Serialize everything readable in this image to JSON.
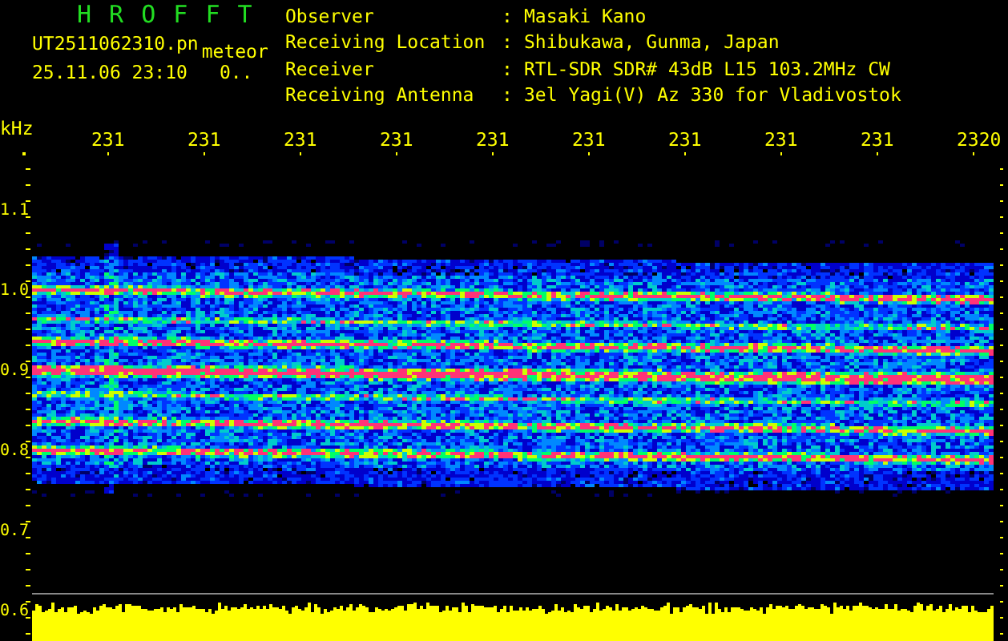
{
  "header": {
    "app_title": "H R O F F T",
    "file_name": "UT2511062310.pn",
    "mode": "meteor",
    "timestamp": "25.11.06 23:10",
    "count": "0..",
    "fields": [
      {
        "label": "Observer",
        "separator": ":",
        "value": "Masaki Kano"
      },
      {
        "label": "Receiving Location",
        "separator": ":",
        "value": "Shibukawa, Gunma, Japan"
      },
      {
        "label": "Receiver",
        "separator": ":",
        "value": "RTL-SDR SDR# 43dB L15 103.2MHz CW"
      },
      {
        "label": "Receiving Antenna",
        "separator": ":",
        "value": "3el Yagi(V) Az 330 for Vladivostok"
      }
    ]
  },
  "plot": {
    "unit": "kHz",
    "time_labels": [
      "231",
      "231",
      "231",
      "231",
      "231",
      "231",
      "231",
      "231",
      "231",
      "2320"
    ],
    "frequency_labels": [
      "1.1",
      "1.0",
      "0.9",
      "0.8",
      "0.7",
      "0.6"
    ]
  }
}
